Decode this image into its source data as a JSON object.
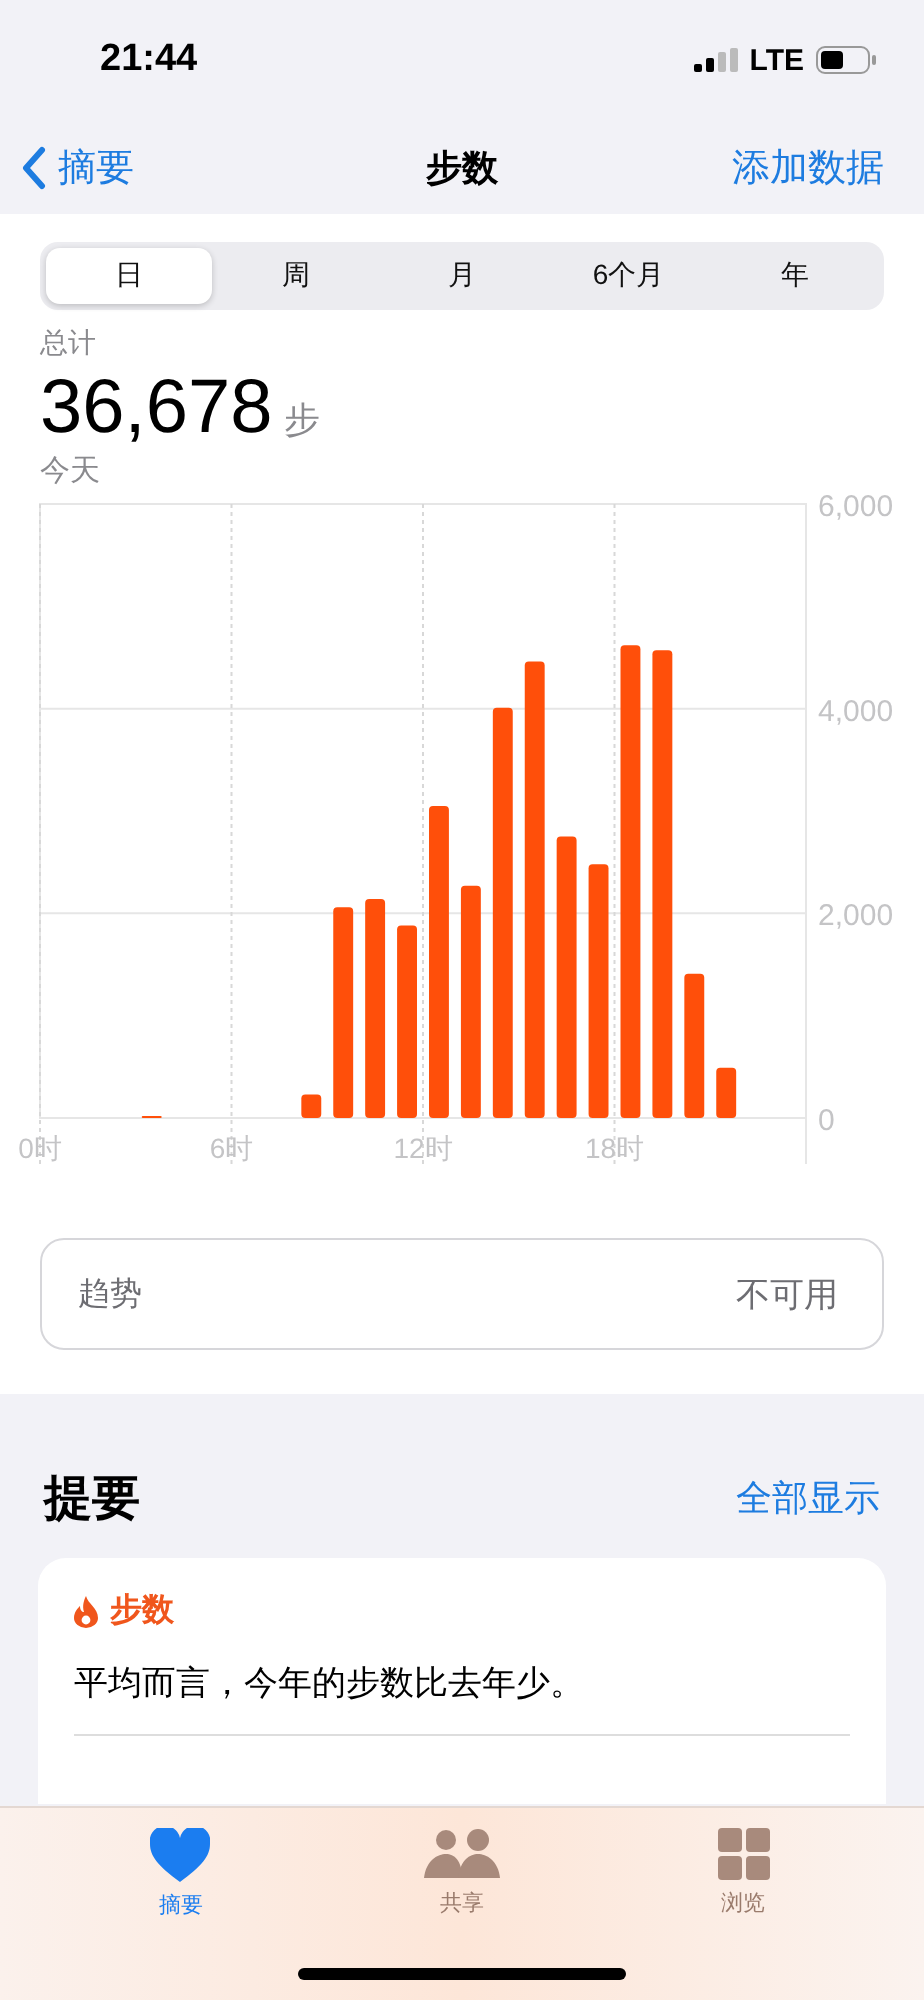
{
  "status_bar": {
    "time": "21:44",
    "network": "LTE"
  },
  "nav": {
    "back": "摘要",
    "title": "步数",
    "action": "添加数据"
  },
  "segments": [
    {
      "label": "日",
      "selected": true
    },
    {
      "label": "周",
      "selected": false
    },
    {
      "label": "月",
      "selected": false
    },
    {
      "label": "6个月",
      "selected": false
    },
    {
      "label": "年",
      "selected": false
    }
  ],
  "total": {
    "label": "总计",
    "value": "36,678",
    "unit": "步",
    "date": "今天"
  },
  "chart_data": {
    "type": "bar",
    "x": [
      3.5,
      8.5,
      9.5,
      10.5,
      11.5,
      12.5,
      13.5,
      14.5,
      15.5,
      16.5,
      17.5,
      18.5,
      19.5,
      20.5,
      21.5
    ],
    "xlim": [
      0,
      24
    ],
    "grid": true,
    "series": [
      {
        "color": "#ff4f0a",
        "values": [
          10,
          230,
          2060,
          2140,
          1880,
          3050,
          2270,
          4010,
          4460,
          2750,
          2480,
          4620,
          4570,
          1410,
          490
        ]
      }
    ],
    "ylim": [
      0,
      6000
    ],
    "yticks": [
      {
        "value": 0,
        "label": "0"
      },
      {
        "value": 2000,
        "label": "2,000"
      },
      {
        "value": 4000,
        "label": "4,000"
      },
      {
        "value": 6000,
        "label": "6,000"
      }
    ],
    "xticks": [
      {
        "value": 0,
        "label": "0时"
      },
      {
        "value": 6,
        "label": "6时"
      },
      {
        "value": 12,
        "label": "12时"
      },
      {
        "value": 18,
        "label": "18时"
      }
    ]
  },
  "trend": {
    "label": "趋势",
    "value": "不可用"
  },
  "highlights": {
    "title": "提要",
    "action": "全部显示",
    "card": {
      "category": "步数",
      "text": "平均而言，今年的步数比去年少。"
    }
  },
  "tab_bar": [
    {
      "label": "摘要",
      "selected": true
    },
    {
      "label": "共享",
      "selected": false
    },
    {
      "label": "浏览",
      "selected": false
    }
  ]
}
